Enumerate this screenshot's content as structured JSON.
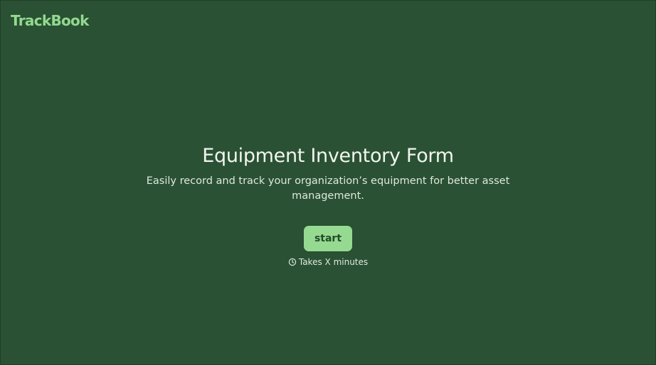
{
  "brand": {
    "name": "TrackBook"
  },
  "hero": {
    "title": "Equipment Inventory Form",
    "subtitle": "Easily record and track your organization’s equipment for better asset management.",
    "start_label": "start",
    "duration_text": "Takes X minutes",
    "duration_icon": "clock-icon"
  },
  "colors": {
    "background": "#2a5133",
    "accent": "#95da90",
    "text": "#f1f6ef"
  }
}
